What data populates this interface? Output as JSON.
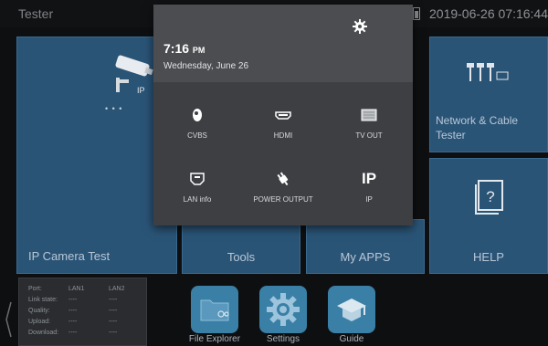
{
  "status": {
    "app_title": "Tester",
    "datetime": "2019-06-26 07:16:44"
  },
  "tiles": {
    "ip_camera": "IP Camera Test",
    "ip_camera_ip_tag": "IP",
    "ip_camera_more": "• • •",
    "tools": "Tools",
    "my_apps": "My APPS",
    "network_line1": "Network & Cable",
    "network_line2": "Tester",
    "help": "HELP"
  },
  "dropdown": {
    "time": "7:16",
    "ampm": "PM",
    "date": "Wednesday, June 26",
    "items": [
      {
        "label": "CVBS",
        "icon": "cvbs-camera-icon"
      },
      {
        "label": "HDMI",
        "icon": "hdmi-icon"
      },
      {
        "label": "TV OUT",
        "icon": "tv-out-icon"
      },
      {
        "label": "LAN info",
        "icon": "lan-icon"
      },
      {
        "label": "POWER OUTPUT",
        "icon": "power-plug-icon"
      },
      {
        "label": "IP",
        "icon": "ip-text-icon",
        "icon_text": "IP"
      }
    ]
  },
  "ports": {
    "headers": [
      "Port:",
      "LAN1",
      "LAN2"
    ],
    "rows": [
      {
        "label": "Link state:",
        "lan1": "----",
        "lan2": "----"
      },
      {
        "label": "Quality:",
        "lan1": "----",
        "lan2": "----"
      },
      {
        "label": "Upload:",
        "lan1": "----",
        "lan2": "----"
      },
      {
        "label": "Download:",
        "lan1": "----",
        "lan2": "----"
      }
    ]
  },
  "dock": [
    {
      "label": "File Explorer",
      "icon": "folder-icon"
    },
    {
      "label": "Settings",
      "icon": "gear-icon"
    },
    {
      "label": "Guide",
      "icon": "graduation-cap-icon"
    }
  ],
  "colors": {
    "tile": "#2a5476",
    "dropdown": "#3d3f42",
    "dock_icon": "#3a7fa6"
  }
}
